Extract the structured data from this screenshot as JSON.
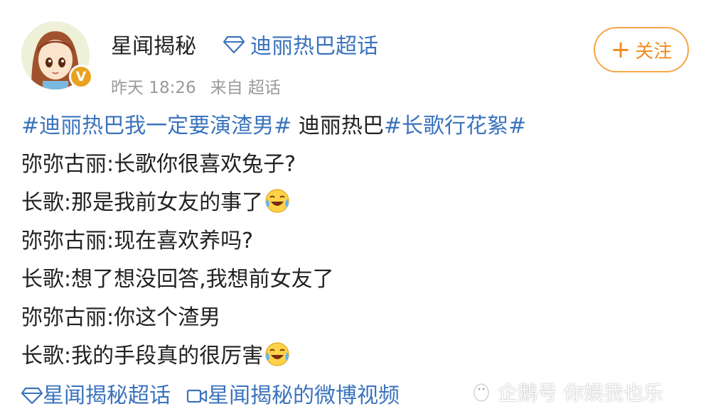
{
  "post": {
    "username": "星闻揭秘",
    "supertopic": "迪丽热巴超话",
    "time": "昨天 18:26",
    "source": "来自 超话",
    "follow_label": "关注",
    "follow_icon": "plus-icon",
    "verified_icon": "v-badge-icon",
    "body": {
      "hashtag1": "#迪丽热巴我一定要演渣男#",
      "mention": " 迪丽热巴",
      "hashtag2": "#长歌行花絮#",
      "lines": [
        {
          "speaker": "弥弥古丽",
          "text": "长歌你很喜欢兔子?",
          "emoji": ""
        },
        {
          "speaker": "长歌",
          "text": "那是我前女友的事了",
          "emoji": "laugh-cry-emoji"
        },
        {
          "speaker": "弥弥古丽",
          "text": "现在喜欢养吗?",
          "emoji": ""
        },
        {
          "speaker": "长歌",
          "text": "想了想没回答,我想前女友了",
          "emoji": ""
        },
        {
          "speaker": "弥弥古丽",
          "text": "你这个渣男",
          "emoji": ""
        },
        {
          "speaker": "长歌",
          "text": "我的手段真的很厉害",
          "emoji": "laugh-cry-emoji"
        }
      ],
      "colon": ":"
    },
    "footer": {
      "supertopic_link": "星闻揭秘超话",
      "video_link": "星闻揭秘的微博视频"
    }
  },
  "watermark": "企鹅号 你娱我也乐",
  "colors": {
    "link": "#3a73bd",
    "follow": "#f08a1c",
    "meta": "#9a9a9a",
    "badge": "#e8a21d"
  }
}
